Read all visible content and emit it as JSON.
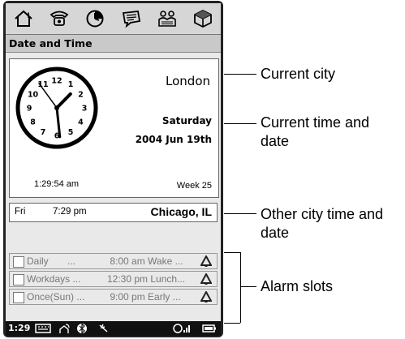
{
  "toolbar": {
    "icons": [
      "home-alert-icon",
      "phone-icon",
      "clock-icon",
      "messages-icon",
      "contacts-icon",
      "cube-icon"
    ]
  },
  "title": "Date and Time",
  "main": {
    "city": "London",
    "day": "Saturday",
    "date": "2004 Jun 19th",
    "time": "1:29:54 am",
    "week": "Week 25",
    "clock_face": {
      "numbers": [
        "12",
        "1",
        "2",
        "3",
        "4",
        "5",
        "6",
        "7",
        "8",
        "9",
        "10",
        "11"
      ],
      "hour": 1,
      "minute": 29,
      "second": 54
    }
  },
  "other_city": {
    "day": "Fri",
    "time": "7:29 pm",
    "city": "Chicago, IL"
  },
  "alarms": [
    {
      "name": "Daily       ...",
      "time": " 8:00 am Wake ..."
    },
    {
      "name": "Workdays ...",
      "time": "12:30 pm Lunch..."
    },
    {
      "name": "Once(Sun) ...",
      "time": " 9:00 pm Early ..."
    }
  ],
  "status_bar": {
    "time": "1:29",
    "icons": [
      "keyboard-icon",
      "network-icon",
      "bluetooth-icon",
      "ir-icon",
      "signal-icon",
      "battery-icon"
    ]
  },
  "callouts": {
    "current_city": "Current city",
    "current_time_1": "Current time and",
    "current_time_2": "date",
    "other_city_1": "Other city time and",
    "other_city_2": "date",
    "alarm_slots": "Alarm slots"
  }
}
